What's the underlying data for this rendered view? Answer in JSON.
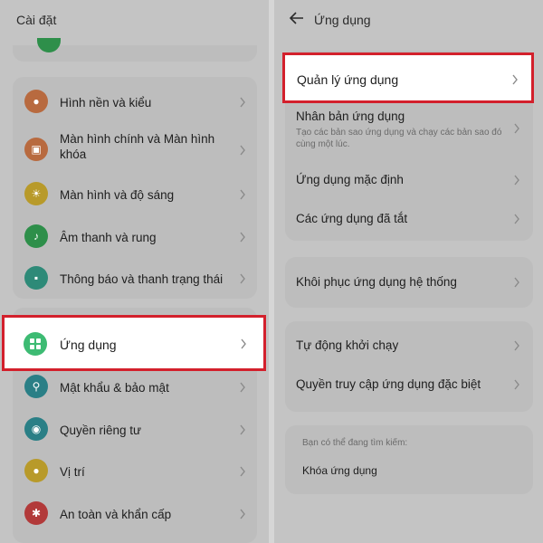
{
  "left": {
    "title": "Cài đặt",
    "items": [
      {
        "label": "Hình nền và kiểu",
        "icon": "palette-icon",
        "color": "#b86a3f"
      },
      {
        "label": "Màn hình chính và Màn hình khóa",
        "icon": "image-icon",
        "color": "#b86a3f"
      },
      {
        "label": "Màn hình và độ sáng",
        "icon": "sun-icon",
        "color": "#b89a2a"
      },
      {
        "label": "Âm thanh và rung",
        "icon": "bell-icon",
        "color": "#2e8f4a"
      },
      {
        "label": "Thông báo và thanh trạng thái",
        "icon": "notification-icon",
        "color": "#2e8a78"
      },
      {
        "label": "Ứng dụng",
        "icon": "apps-grid-icon",
        "color": "#3dbb73"
      },
      {
        "label": "Mật khẩu & bảo mật",
        "icon": "key-icon",
        "color": "#2a7f86"
      },
      {
        "label": "Quyền riêng tư",
        "icon": "eye-icon",
        "color": "#2a7f86"
      },
      {
        "label": "Vị trí",
        "icon": "location-pin-icon",
        "color": "#b89a2a"
      },
      {
        "label": "An toàn và khẩn cấp",
        "icon": "asterisk-icon",
        "color": "#b23a3a"
      }
    ]
  },
  "right": {
    "title": "Ứng dụng",
    "group1": [
      {
        "label": "Quản lý ứng dụng"
      },
      {
        "label": "Nhân bản ứng dụng",
        "sub": "Tạo các bản sao ứng dụng và chạy các bản sao đó cùng một lúc."
      },
      {
        "label": "Ứng dụng mặc định"
      },
      {
        "label": "Các ứng dụng đã tắt"
      }
    ],
    "group2": [
      {
        "label": "Khôi phục ứng dụng hệ thống"
      }
    ],
    "group3": [
      {
        "label": "Tự động khởi chạy"
      },
      {
        "label": "Quyền truy cập ứng dụng đặc biệt"
      }
    ],
    "search": {
      "hint": "Bạn có thể đang tìm kiếm:",
      "item": "Khóa ứng dụng"
    }
  },
  "colors": {
    "highlight_border": "#d3202c"
  }
}
